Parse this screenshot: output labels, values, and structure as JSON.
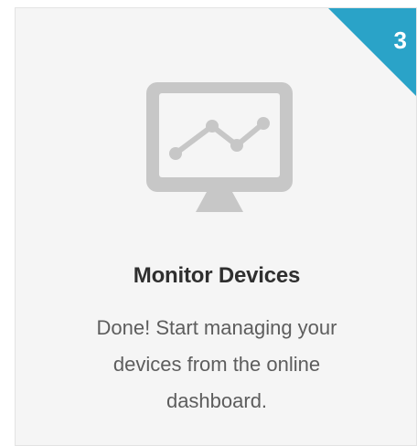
{
  "step": {
    "number": "3",
    "title": "Monitor Devices",
    "description": "Done! Start managing your devices from the online dashboard."
  },
  "icons": {
    "monitor": "monitor-with-line-chart-icon"
  },
  "colors": {
    "card_background": "#f5f5f5",
    "card_border": "#e3e3e3",
    "badge": "#2aa3c8",
    "icon": "#c7c7c7",
    "title": "#2f2f2f",
    "description": "#5d5d5d"
  }
}
